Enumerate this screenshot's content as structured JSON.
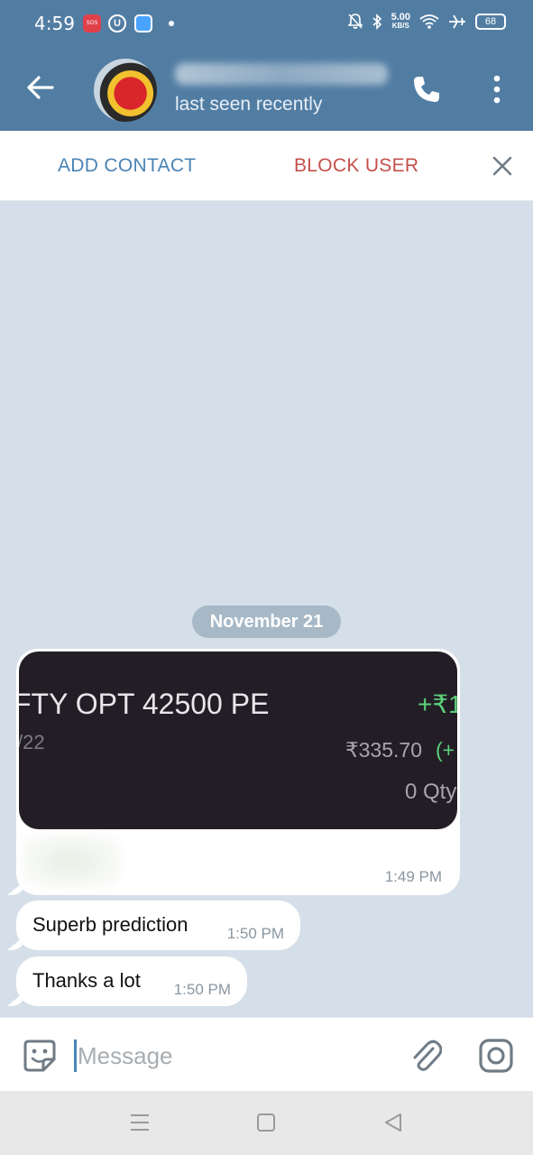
{
  "status_bar": {
    "time": "4:59",
    "sos_label": "SOS",
    "u_label": "U",
    "speed_value": "5.00",
    "speed_unit": "KB/S",
    "battery": "68"
  },
  "header": {
    "status": "last seen recently"
  },
  "action_bar": {
    "add_contact": "ADD CONTACT",
    "block_user": "BLOCK USER"
  },
  "chat": {
    "date": "November 21",
    "image_message": {
      "line1": "FTY OPT 42500 PE",
      "line1_gain": "+₹1",
      "line2": "/22",
      "line3": "₹335.70",
      "line3_gain": "(+",
      "line4": "0 Qty",
      "time": "1:49 PM"
    },
    "messages": [
      {
        "text": "Superb prediction",
        "time": "1:50 PM"
      },
      {
        "text": "Thanks a lot",
        "time": "1:50 PM"
      }
    ]
  },
  "composer": {
    "placeholder": "Message"
  },
  "colors": {
    "header": "#527da3",
    "chat_background": "#d5dfe9",
    "add_contact": "#4a84b6",
    "block_user": "#c4504a"
  }
}
